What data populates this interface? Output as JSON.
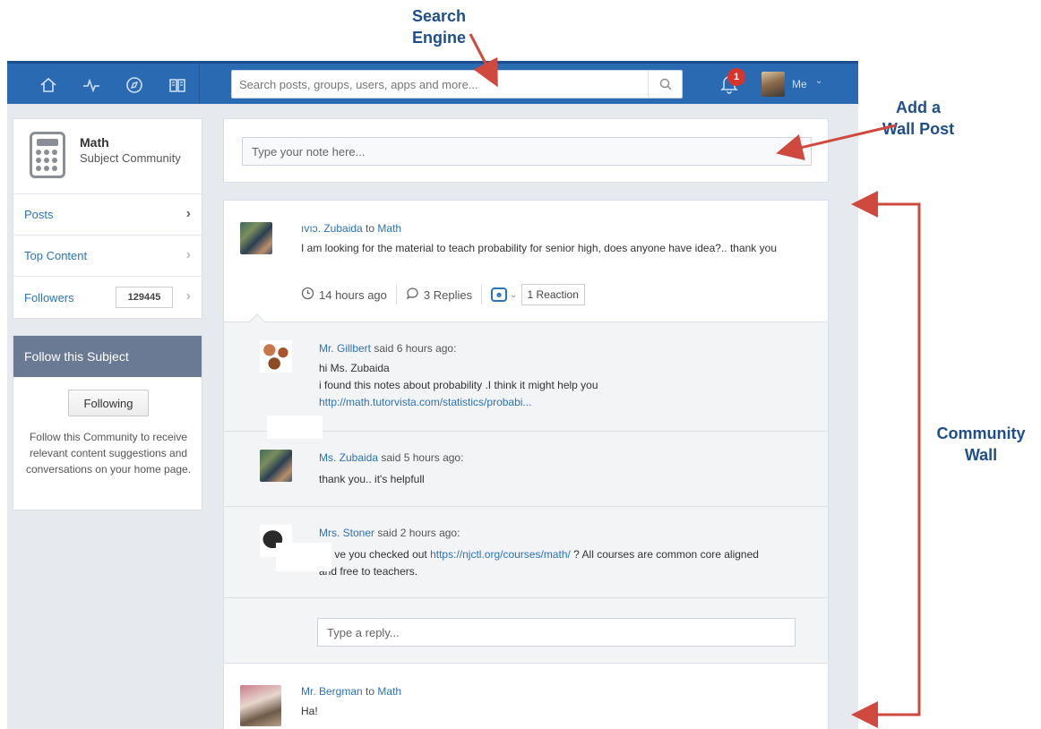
{
  "annotations": {
    "search_engine": "Search\nEngine",
    "add_wall_post": "Add a\nWall Post",
    "community_wall": "Community\nWall"
  },
  "topbar": {
    "nav_icons": [
      "home-icon",
      "activity-icon",
      "compass-icon",
      "book-icon"
    ],
    "search_placeholder": "Search posts, groups, users, apps and more...",
    "notification_count": "1",
    "me_label": "Me",
    "brand_color": "#2a6ab3"
  },
  "subject": {
    "name": "Math",
    "type": "Subject Community",
    "nav": [
      {
        "label": "Posts"
      },
      {
        "label": "Top Content"
      },
      {
        "label": "Followers",
        "count": "129445"
      }
    ]
  },
  "follow": {
    "title": "Follow this Subject",
    "button": "Following",
    "description": "Follow this Community to receive relevant content suggestions and conversations on your home page."
  },
  "note": {
    "placeholder": "Type your note here..."
  },
  "posts": [
    {
      "author": "Ms. Zubaida",
      "author_visible": "ıvıɔ. Zubaida",
      "to_word": "to",
      "target": "Math",
      "text": "I am looking for the material to teach probability for senior high, does anyone have idea?.. thank you",
      "time": "14 hours ago",
      "replies_label": "3 Replies",
      "reaction_label": "1 Reaction",
      "replies": [
        {
          "author": "Mr. Gillbert",
          "said": "said 6 hours ago:",
          "line1": "hi Ms. Zubaida",
          "line2": "i found this notes about probability .I think it might help you",
          "link": "http://math.tutorvista.com/statistics/probabi..."
        },
        {
          "author": "Ms. Zubaida",
          "said": "said 5 hours ago:",
          "line1": "thank you.. it's helpfull"
        },
        {
          "author": "Mrs. Stoner",
          "said": "said 2 hours ago:",
          "pre": "ve you checked out",
          "link": "https://njctl.org/courses/math/",
          "post": "? All courses are common core aligned",
          "line2": "and free to teachers."
        }
      ],
      "reply_placeholder": "Type a reply..."
    },
    {
      "author": "Mr. Bergman",
      "to_word": "to",
      "target": "Math",
      "text": "Ha!"
    }
  ]
}
